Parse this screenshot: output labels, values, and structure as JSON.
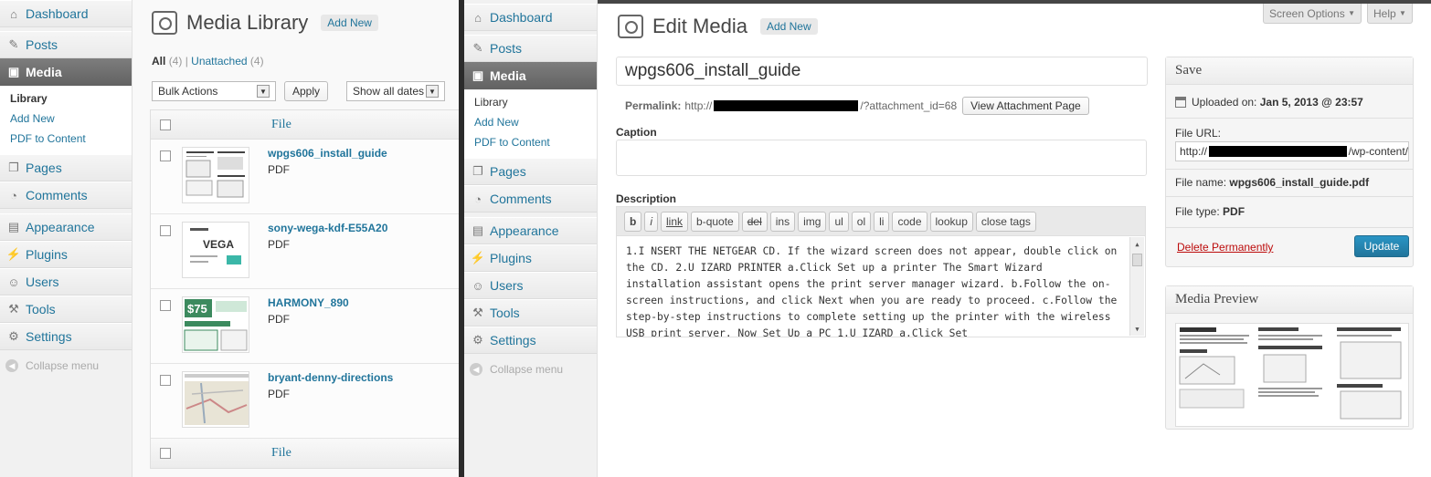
{
  "left": {
    "menu": {
      "dashboard": "Dashboard",
      "posts": "Posts",
      "media": "Media",
      "media_sub": [
        "Library",
        "Add New",
        "PDF to Content"
      ],
      "pages": "Pages",
      "comments": "Comments",
      "appearance": "Appearance",
      "plugins": "Plugins",
      "users": "Users",
      "tools": "Tools",
      "settings": "Settings",
      "collapse": "Collapse menu"
    },
    "page_title": "Media Library",
    "add_new": "Add New",
    "filters": {
      "all": "All",
      "all_count": "(4)",
      "separator": "|",
      "unattached": "Unattached",
      "unattached_count": "(4)"
    },
    "bulk_actions": "Bulk Actions",
    "apply": "Apply",
    "show_dates": "Show all dates",
    "column_file": "File",
    "rows": [
      {
        "title": "wpgs606_install_guide",
        "type": "PDF"
      },
      {
        "title": "sony-wega-kdf-E55A20",
        "type": "PDF"
      },
      {
        "title": "HARMONY_890",
        "type": "PDF"
      },
      {
        "title": "bryant-denny-directions",
        "type": "PDF"
      }
    ]
  },
  "right": {
    "menu": {
      "dashboard": "Dashboard",
      "posts": "Posts",
      "media": "Media",
      "media_sub": [
        "Library",
        "Add New",
        "PDF to Content"
      ],
      "pages": "Pages",
      "comments": "Comments",
      "appearance": "Appearance",
      "plugins": "Plugins",
      "users": "Users",
      "tools": "Tools",
      "settings": "Settings",
      "collapse": "Collapse menu"
    },
    "screen_options": "Screen Options",
    "help": "Help",
    "page_title": "Edit Media",
    "add_new": "Add New",
    "title_value": "wpgs606_install_guide",
    "permalink_label": "Permalink:",
    "permalink_prefix": "http://",
    "permalink_suffix": "/?attachment_id=68",
    "view_attachment": "View Attachment Page",
    "caption_label": "Caption",
    "description_label": "Description",
    "quicktags": [
      "b",
      "i",
      "link",
      "b-quote",
      "del",
      "ins",
      "img",
      "ul",
      "ol",
      "li",
      "code",
      "lookup",
      "close tags"
    ],
    "description_text": "1.I NSERT THE  NETGEAR CD. If the wizard screen does not appear, double click on the CD. 2.U IZARD PRINTER a.Click  Set up a printer The Smart Wizard installation assistant  opens the print server manager wizard. b.Follow the on-screen instructions, and click  Next  when you are ready to proceed. c.Follow the step-by-step instructions to complete setting up the printer with the  wireless USB print server. Now  Set Up a PC 1.U IZARD a.Click  Set",
    "save_box": {
      "title": "Save",
      "uploaded_label": "Uploaded on:",
      "uploaded_value": "Jan 5, 2013 @ 23:57",
      "file_url_label": "File URL:",
      "file_url_prefix": "http://",
      "file_url_suffix": "/wp-content/",
      "file_name_label": "File name:",
      "file_name_value": "wpgs606_install_guide.pdf",
      "file_type_label": "File type:",
      "file_type_value": "PDF",
      "delete": "Delete Permanently",
      "update": "Update"
    },
    "preview_box": {
      "title": "Media Preview"
    }
  },
  "colors": {
    "link": "#21759b",
    "active_menu": "#6d6d6d",
    "update_button": "#2a95c5",
    "delete": "#bc0b0b"
  }
}
